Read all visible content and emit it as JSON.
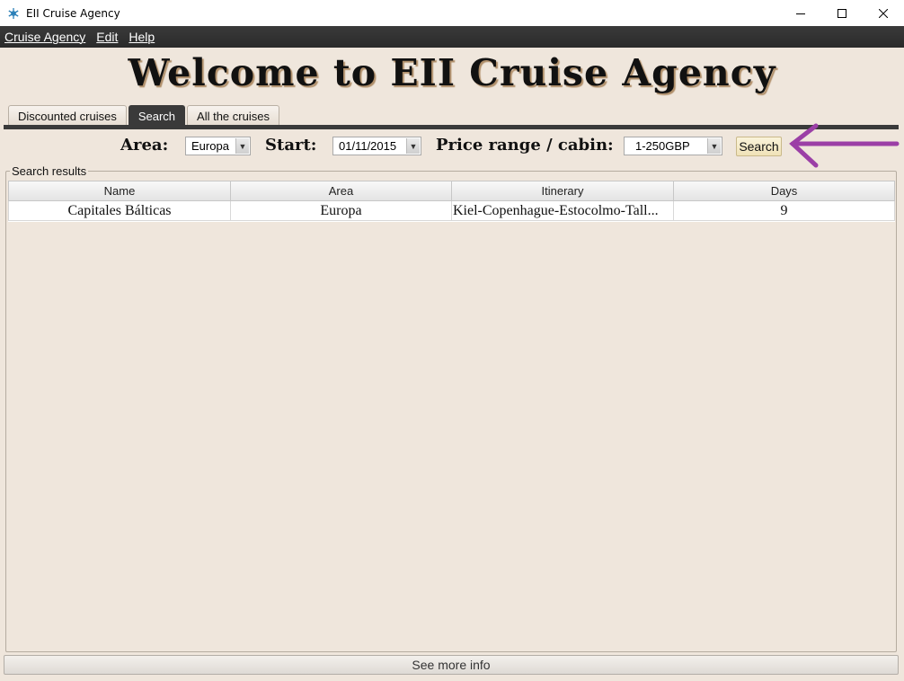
{
  "window": {
    "title": "EII Cruise Agency",
    "icon": "snowflake-icon",
    "controls": [
      "minimize-icon",
      "maximize-icon",
      "close-icon"
    ]
  },
  "menu": [
    "Cruise Agency",
    "Edit",
    "Help"
  ],
  "heading": "Welcome to EII Cruise Agency",
  "tabs": [
    {
      "label": "Discounted cruises",
      "active": false
    },
    {
      "label": "Search",
      "active": true
    },
    {
      "label": "All the cruises",
      "active": false
    }
  ],
  "search": {
    "area_label": "Area:",
    "area_value": "Europa",
    "start_label": "Start:",
    "start_value": "01/11/2015",
    "price_label": "Price range / cabin:",
    "price_value": "1-250GBP",
    "button_label": "Search"
  },
  "results": {
    "legend": "Search results",
    "columns": [
      "Name",
      "Area",
      "Itinerary",
      "Days"
    ],
    "rows": [
      [
        "Capitales Bálticas",
        "Europa",
        "Kiel-Copenhague-Estocolmo-Tall...",
        "9"
      ]
    ]
  },
  "more_info_label": "See more info",
  "colors": {
    "background": "#efe6dc",
    "menubar": "#2e2e2e",
    "annotation_arrow": "#9b3fa6"
  }
}
